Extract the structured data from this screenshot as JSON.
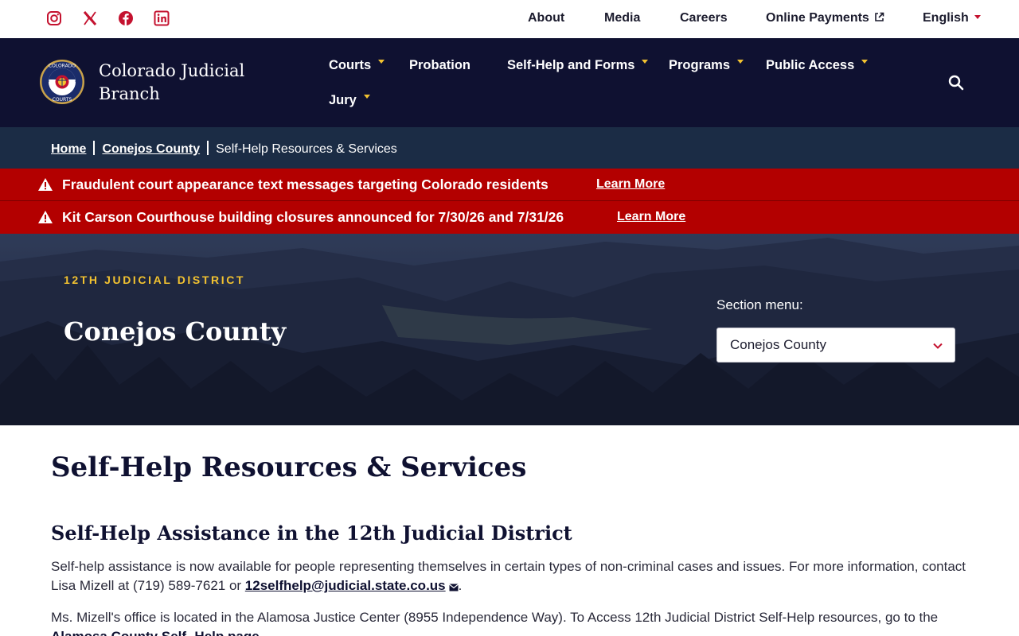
{
  "utility": {
    "social": [
      "instagram-icon",
      "x-twitter-icon",
      "facebook-icon",
      "linkedin-icon"
    ],
    "links": [
      "About",
      "Media",
      "Careers",
      "Online Payments"
    ],
    "language": "English"
  },
  "header": {
    "brand_line1": "Colorado Judicial",
    "brand_line2": "Branch",
    "seal_text_top": "COLORADO",
    "seal_text_bottom": "COURTS",
    "nav": {
      "courts": "Courts",
      "probation": "Probation",
      "selfhelp": "Self-Help and Forms",
      "programs": "Programs",
      "public_access": "Public Access",
      "jury": "Jury"
    }
  },
  "breadcrumb": {
    "home": "Home",
    "county": "Conejos County",
    "current": "Self-Help Resources & Services"
  },
  "alerts": [
    {
      "message": "Fraudulent court appearance text messages targeting Colorado residents",
      "link": "Learn More"
    },
    {
      "message": "Kit Carson Courthouse building closures announced for 7/30/26 and 7/31/26",
      "link": "Learn More"
    }
  ],
  "hero": {
    "eyebrow": "12TH JUDICIAL DISTRICT",
    "title": "Conejos County",
    "section_menu_label": "Section menu:",
    "section_menu_value": "Conejos County"
  },
  "content": {
    "page_title": "Self-Help Resources & Services",
    "section_title": "Self-Help Assistance in the 12th Judicial District",
    "p1_text": "Self-help assistance is now available for people representing themselves in certain types of non-criminal cases and issues. For more information, contact Lisa Mizell at (719) 589-7621 or ",
    "p1_email": "12selfhelp@judicial.state.co.us",
    "p1_end": ".",
    "p2_text": "Ms. Mizell's office is located in the Alamosa Justice Center (8955 Independence Way). To Access 12th Judicial District Self-Help resources, go to the ",
    "p2_link": "Alamosa County Self- Help page",
    "p2_end": "."
  },
  "colors": {
    "navy": "#0f1131",
    "breadcrumb": "#1b2c45",
    "alert_red": "#b30000",
    "accent_gold": "#f2c230",
    "social_red": "#c4122f"
  }
}
